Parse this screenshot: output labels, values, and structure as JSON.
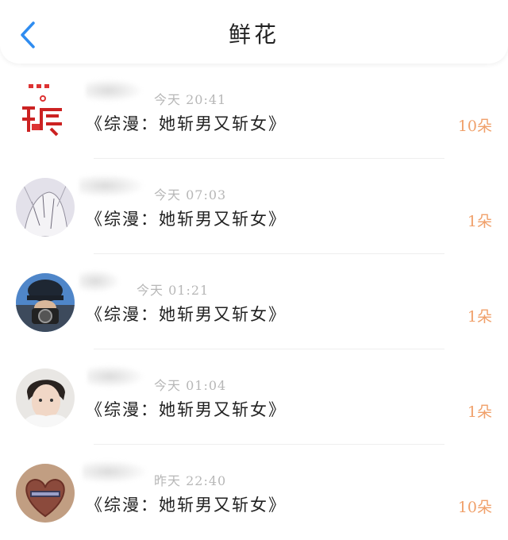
{
  "header": {
    "title": "鲜花",
    "back_icon": "chevron-left-icon",
    "accent": "#2f8cf0"
  },
  "items": [
    {
      "time": "今天 20:41",
      "book": "《综漫：她斩男又斩女》",
      "count": "10朵"
    },
    {
      "time": "今天 07:03",
      "book": "《综漫：她斩男又斩女》",
      "count": "1朵"
    },
    {
      "time": "今天 01:21",
      "book": "《综漫：她斩男又斩女》",
      "count": "1朵"
    },
    {
      "time": "今天 01:04",
      "book": "《综漫：她斩男又斩女》",
      "count": "1朵"
    },
    {
      "time": "昨天 22:40",
      "book": "《综漫：她斩男又斩女》",
      "count": "10朵"
    }
  ],
  "colors": {
    "count": "#f0a06a",
    "time": "#b7b7b7"
  }
}
